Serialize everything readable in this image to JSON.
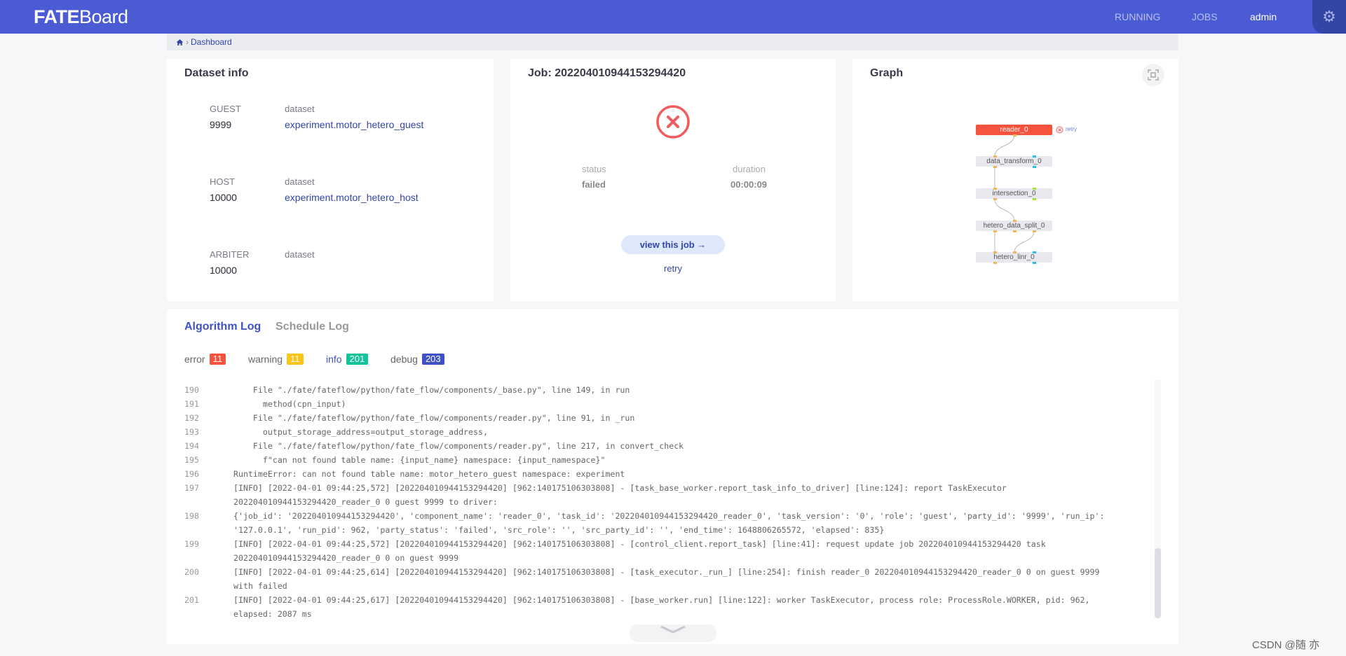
{
  "header": {
    "logo_bold": "FATE",
    "logo_light": "Board",
    "nav": [
      "RUNNING",
      "JOBS",
      "admin"
    ],
    "settings_icon": "gear-icon"
  },
  "breadcrumb": {
    "home_icon": "home-icon",
    "current": "Dashboard"
  },
  "dataset": {
    "title": "Dataset info",
    "rows": [
      {
        "role": "GUEST",
        "id": "9999",
        "col_label": "dataset",
        "name": "experiment.motor_hetero_guest"
      },
      {
        "role": "HOST",
        "id": "10000",
        "col_label": "dataset",
        "name": "experiment.motor_hetero_host"
      },
      {
        "role": "ARBITER",
        "id": "10000",
        "col_label": "dataset",
        "name": ""
      }
    ]
  },
  "job": {
    "title": "Job: 202204010944153294420",
    "status_label": "status",
    "status": "failed",
    "duration_label": "duration",
    "duration": "00:00:09",
    "view_button": "view this job →",
    "retry": "retry",
    "status_color": "#f25c5c"
  },
  "graph": {
    "title": "Graph",
    "nodes": [
      "reader_0",
      "data_transform_0",
      "intersection_0",
      "hetero_data_split_0",
      "hetero_linr_0"
    ],
    "failed_color": "#f5533d",
    "retry_label": "retry"
  },
  "log": {
    "tabs": [
      "Algorithm Log",
      "Schedule Log"
    ],
    "counts": [
      {
        "label": "error",
        "count": "11",
        "color": "#f5533d"
      },
      {
        "label": "warning",
        "count": "11",
        "color": "#fcc419"
      },
      {
        "label": "info",
        "count": "201",
        "color": "#13c39a"
      },
      {
        "label": "debug",
        "count": "203",
        "color": "#3f51c7"
      }
    ],
    "lines": [
      {
        "n": "190",
        "t": [
          "    File \"./fate/fateflow/python/fate_flow/components/_base.py\", line 149, in run"
        ]
      },
      {
        "n": "191",
        "t": [
          "      method(cpn_input)"
        ]
      },
      {
        "n": "192",
        "t": [
          "    File \"./fate/fateflow/python/fate_flow/components/reader.py\", line 91, in _run"
        ]
      },
      {
        "n": "193",
        "t": [
          "      output_storage_address=output_storage_address,"
        ]
      },
      {
        "n": "194",
        "t": [
          "    File \"./fate/fateflow/python/fate_flow/components/reader.py\", line 217, in convert_check"
        ]
      },
      {
        "n": "195",
        "t": [
          "      f\"can not found table name: {input_name} namespace: {input_namespace}\""
        ]
      },
      {
        "n": "196",
        "t": [
          "RuntimeError: can not found table name: motor_hetero_guest namespace: experiment"
        ]
      },
      {
        "n": "197",
        "t": [
          "[INFO] [2022-04-01 09:44:25,572] [202204010944153294420] [962:140175106303808] - [task_base_worker.report_task_info_to_driver] [line:124]: report TaskExecutor",
          "202204010944153294420_reader_0 0 guest 9999 to driver:"
        ]
      },
      {
        "n": "198",
        "t": [
          "{'job_id': '202204010944153294420', 'component_name': 'reader_0', 'task_id': '202204010944153294420_reader_0', 'task_version': '0', 'role': 'guest', 'party_id': '9999', 'run_ip':",
          "'127.0.0.1', 'run_pid': 962, 'party_status': 'failed', 'src_role': '', 'src_party_id': '', 'end_time': 1648806265572, 'elapsed': 835}"
        ]
      },
      {
        "n": "199",
        "t": [
          "[INFO] [2022-04-01 09:44:25,572] [202204010944153294420] [962:140175106303808] - [control_client.report_task] [line:41]: request update job 202204010944153294420 task",
          "202204010944153294420_reader_0 0 on guest 9999"
        ]
      },
      {
        "n": "200",
        "t": [
          "[INFO] [2022-04-01 09:44:25,614] [202204010944153294420] [962:140175106303808] - [task_executor._run_] [line:254]: finish reader_0 202204010944153294420_reader_0 0 on guest 9999",
          "with failed"
        ]
      },
      {
        "n": "201",
        "t": [
          "[INFO] [2022-04-01 09:44:25,617] [202204010944153294420] [962:140175106303808] - [base_worker.run] [line:122]: worker TaskExecutor, process role: ProcessRole.WORKER, pid: 962,",
          "elapsed: 2087 ms"
        ]
      }
    ]
  },
  "watermark": "CSDN @随 亦"
}
